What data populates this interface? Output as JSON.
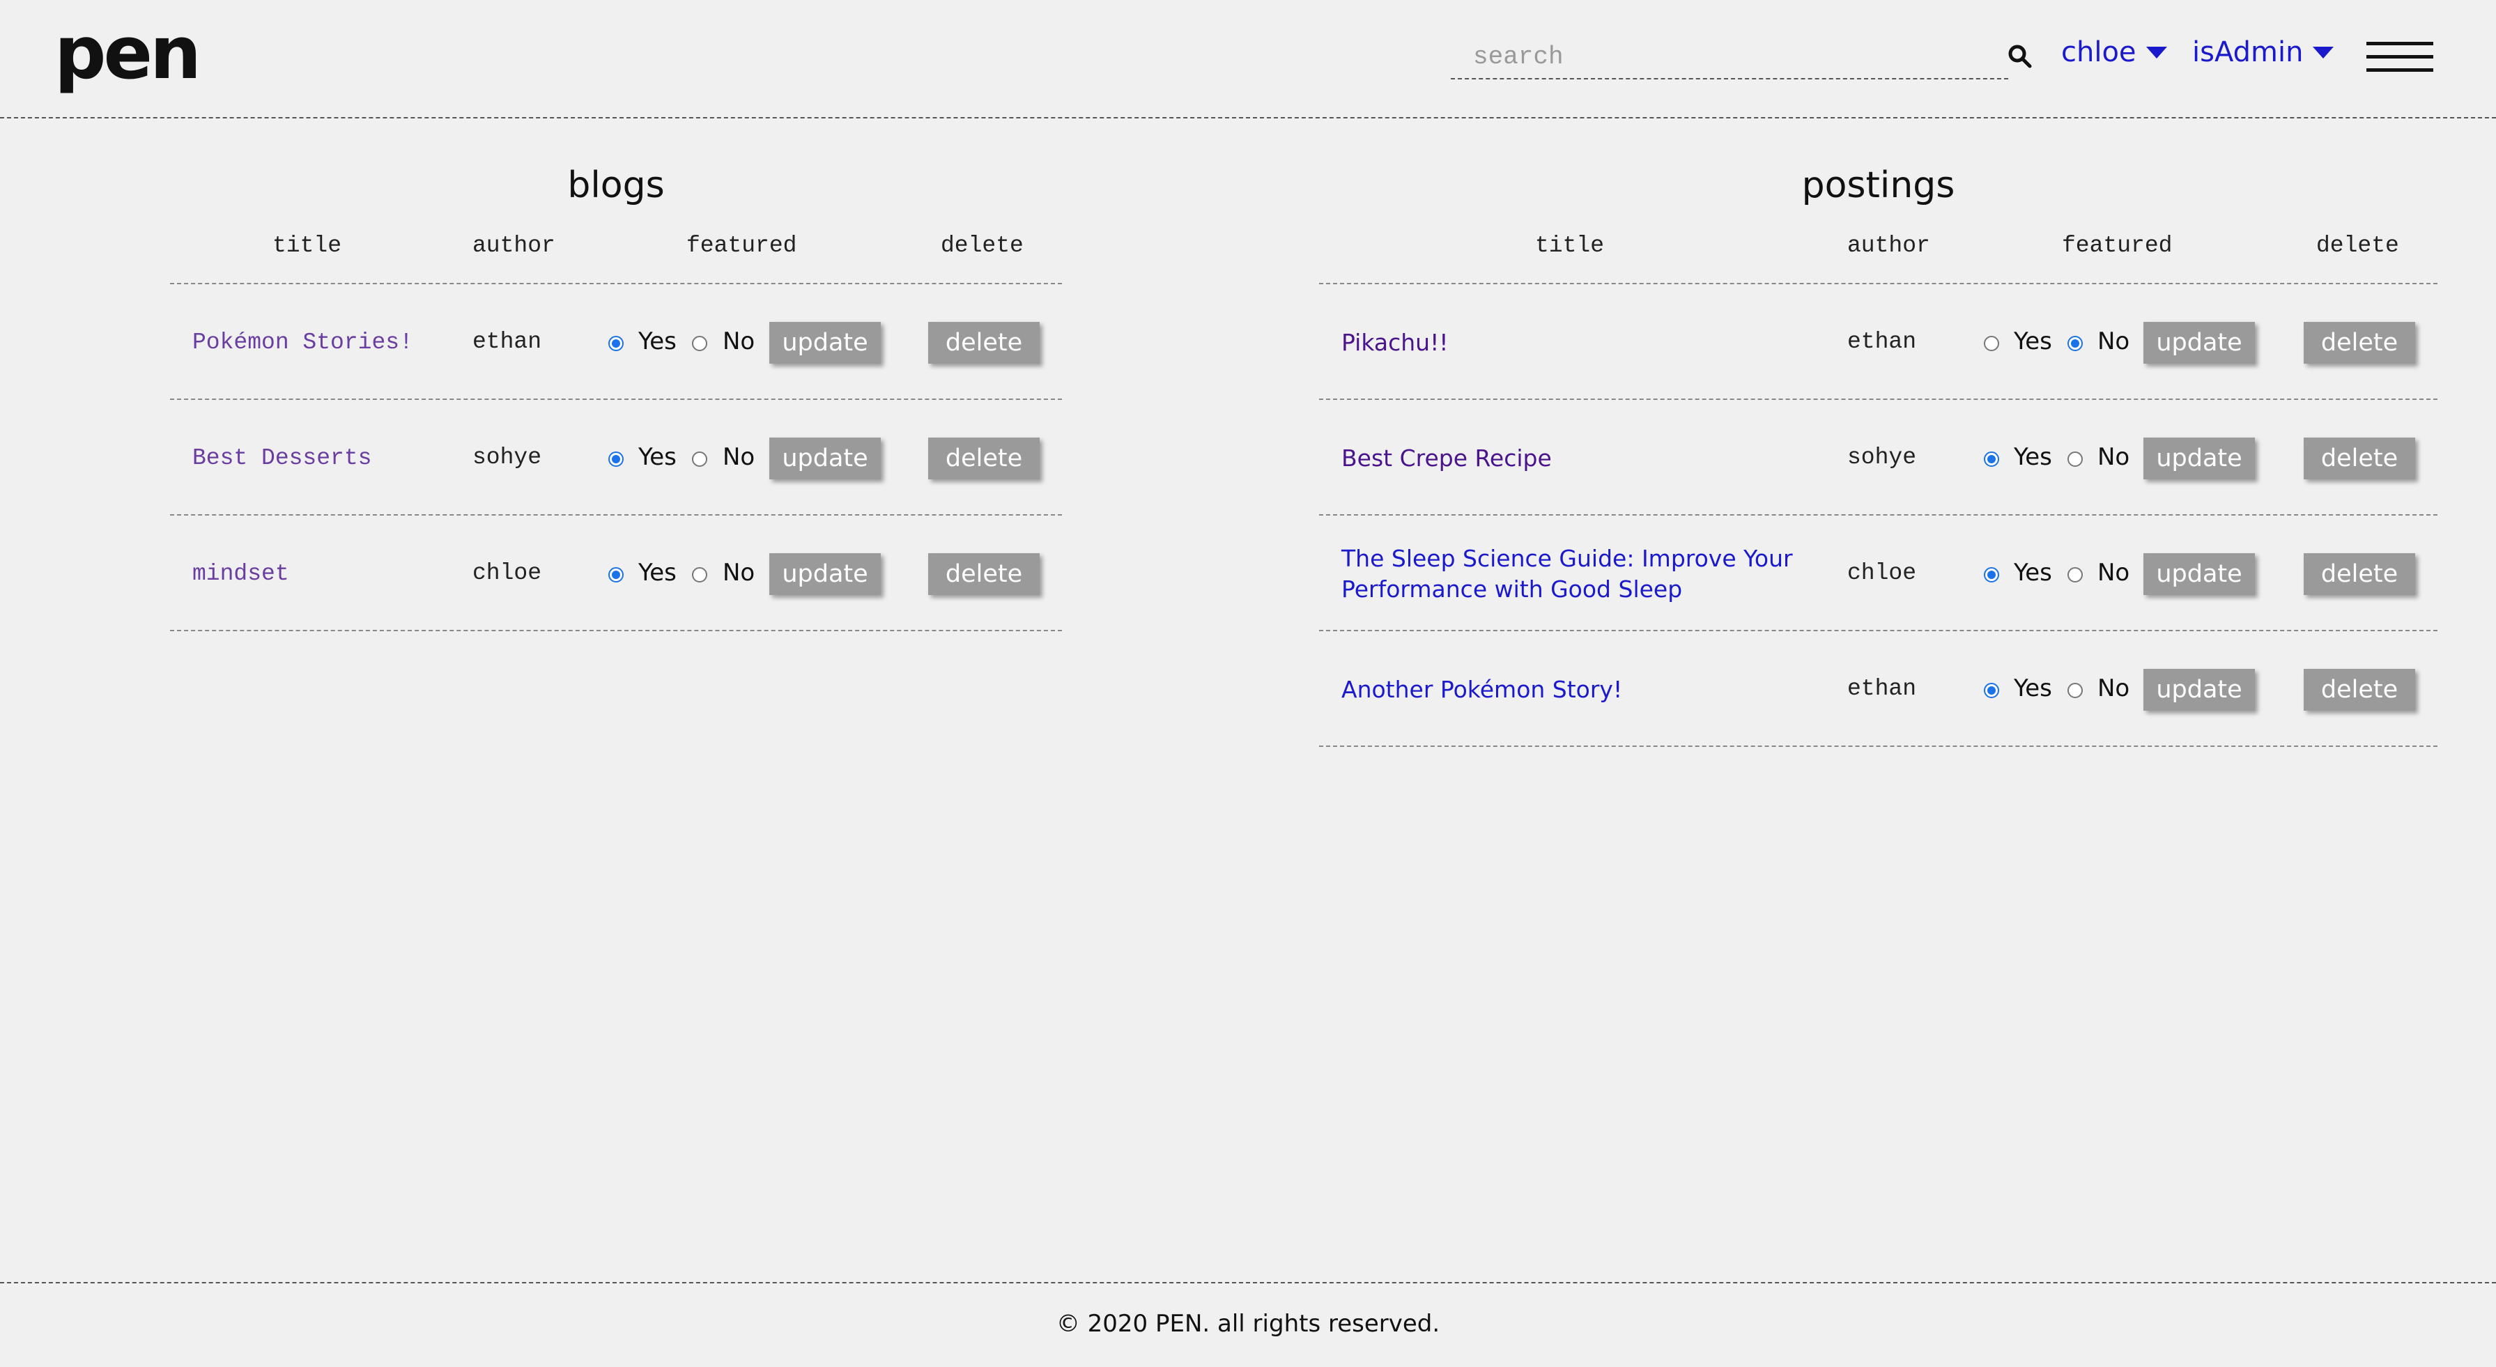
{
  "header": {
    "logo": "pen",
    "search_placeholder": "search",
    "search_value": "",
    "user_menu": "chloe",
    "role_menu": "isAdmin",
    "accent_color": "#1a1acc"
  },
  "blogs": {
    "title": "blogs",
    "columns": [
      "title",
      "author",
      "featured",
      "delete"
    ],
    "rows": [
      {
        "title": "Pokémon Stories!",
        "author": "ethan",
        "featured": "yes",
        "yes_label": "Yes",
        "no_label": "No",
        "update_label": "update",
        "delete_label": "delete"
      },
      {
        "title": "Best Desserts",
        "author": "sohye",
        "featured": "yes",
        "yes_label": "Yes",
        "no_label": "No",
        "update_label": "update",
        "delete_label": "delete"
      },
      {
        "title": "mindset",
        "author": "chloe",
        "featured": "yes",
        "yes_label": "Yes",
        "no_label": "No",
        "update_label": "update",
        "delete_label": "delete"
      }
    ]
  },
  "postings": {
    "title": "postings",
    "columns": [
      "title",
      "author",
      "featured",
      "delete"
    ],
    "rows": [
      {
        "title": "Pikachu!!",
        "author": "ethan",
        "featured": "no",
        "link_color": "#4a148c",
        "yes_label": "Yes",
        "no_label": "No",
        "update_label": "update",
        "delete_label": "delete"
      },
      {
        "title": "Best Crepe Recipe",
        "author": "sohye",
        "featured": "yes",
        "link_color": "#4a148c",
        "yes_label": "Yes",
        "no_label": "No",
        "update_label": "update",
        "delete_label": "delete"
      },
      {
        "title_line1": "The Sleep Science Guide: Improve Your",
        "title_line2": "Performance with Good Sleep",
        "author": "chloe",
        "featured": "yes",
        "link_color": "#1a1acc",
        "yes_label": "Yes",
        "no_label": "No",
        "update_label": "update",
        "delete_label": "delete"
      },
      {
        "title": "Another Pokémon Story!",
        "author": "ethan",
        "featured": "yes",
        "link_color": "#1a1acc",
        "yes_label": "Yes",
        "no_label": "No",
        "update_label": "update",
        "delete_label": "delete"
      }
    ]
  },
  "footer": {
    "text": "© 2020 PEN. all rights reserved."
  }
}
